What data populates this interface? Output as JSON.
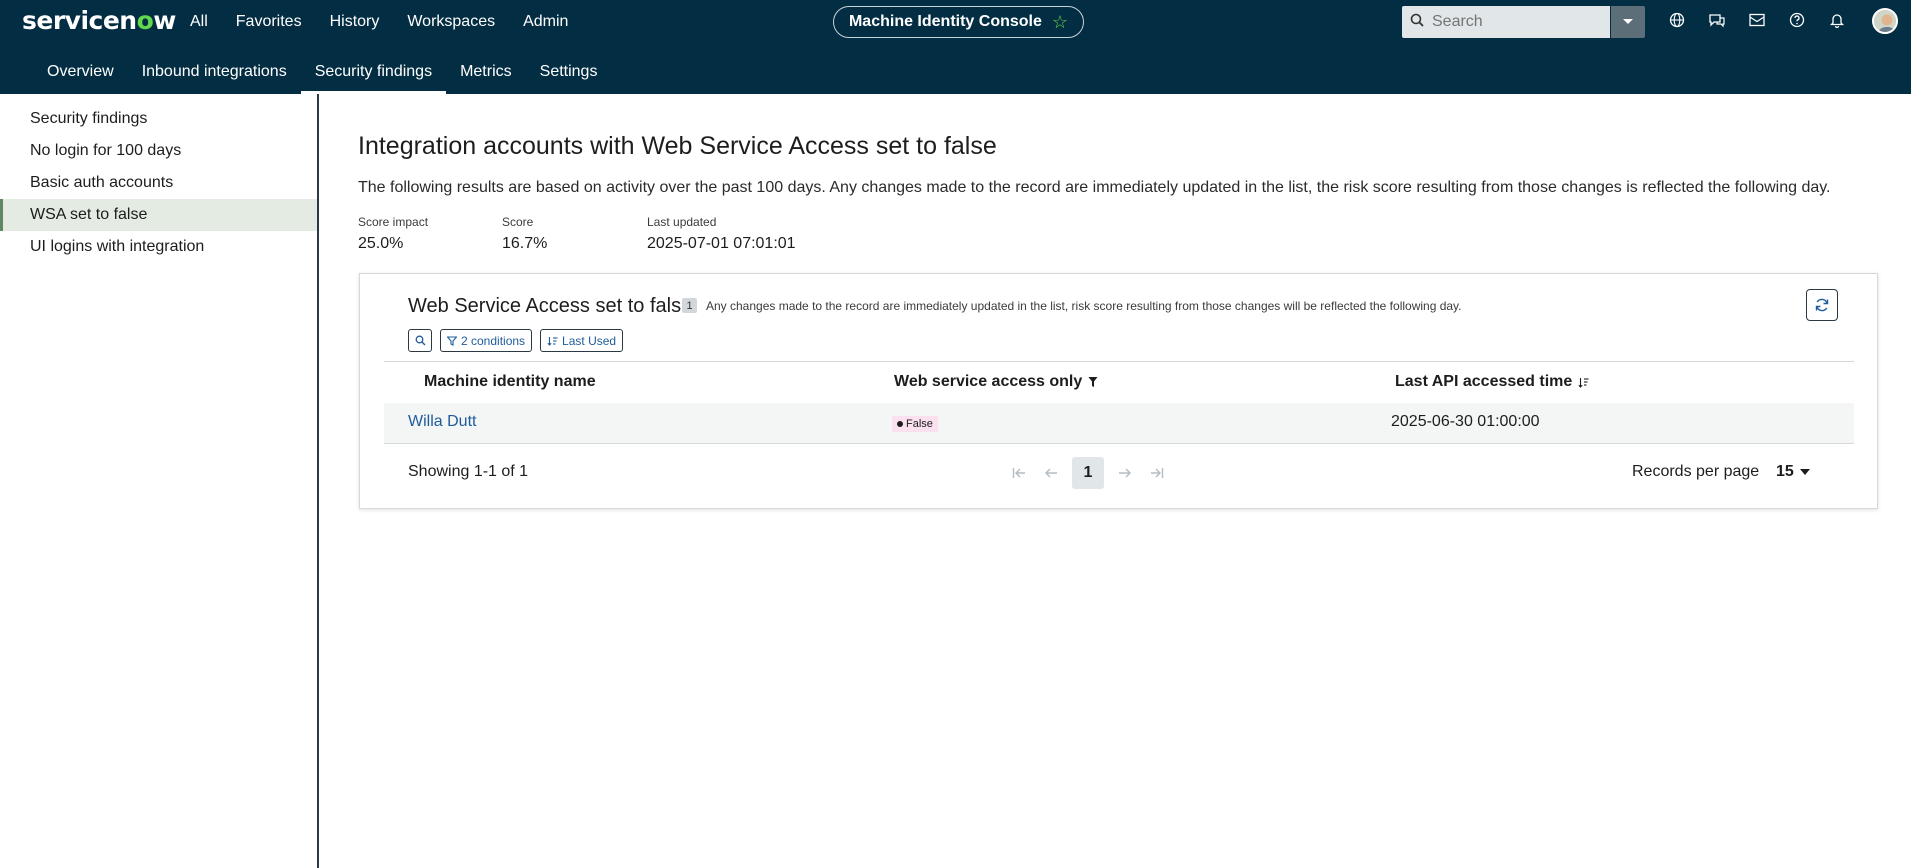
{
  "app": {
    "logo_prefix": "servicen",
    "logo_o": "o",
    "logo_suffix": "w",
    "console_name": "Machine Identity Console"
  },
  "nav": {
    "items": [
      "All",
      "Favorites",
      "History",
      "Workspaces",
      "Admin"
    ]
  },
  "search": {
    "placeholder": "Search"
  },
  "header_icons": [
    "globe-icon",
    "chat-icon",
    "inbox-icon",
    "help-icon",
    "bell-icon"
  ],
  "tabs": [
    {
      "label": "Overview",
      "active": false
    },
    {
      "label": "Inbound integrations",
      "active": false
    },
    {
      "label": "Security findings",
      "active": true
    },
    {
      "label": "Metrics",
      "active": false
    },
    {
      "label": "Settings",
      "active": false
    }
  ],
  "sidebar": {
    "items": [
      {
        "label": "Security findings",
        "active": false
      },
      {
        "label": "No login for 100 days",
        "active": false
      },
      {
        "label": "Basic auth accounts",
        "active": false
      },
      {
        "label": "WSA set to false",
        "active": true
      },
      {
        "label": "UI logins with integration",
        "active": false
      }
    ]
  },
  "page": {
    "title": "Integration accounts with Web Service Access set to false",
    "description": "The following results are based on activity over the past 100 days. Any changes made to the record are immediately updated in the list, the risk score resulting from those changes is reflected the following day.",
    "stats": [
      {
        "label": "Score impact",
        "value": "25.0%"
      },
      {
        "label": "Score",
        "value": "16.7%"
      },
      {
        "label": "Last updated",
        "value": "2025-07-01 07:01:01"
      }
    ]
  },
  "card": {
    "title": "Web Service Access set to false",
    "count": "1",
    "note": "Any changes made to the record are immediately updated in the list, risk score resulting from those changes will be reflected the following day.",
    "chips": {
      "conditions": "2 conditions",
      "sort": "Last Used"
    },
    "columns": [
      "Machine identity name",
      "Web service access only",
      "Last API accessed time"
    ],
    "rows": [
      {
        "name": "Willa Dutt",
        "wsa": "False",
        "last_access": "2025-06-30 01:00:00"
      }
    ],
    "footer": {
      "showing": "Showing 1-1 of 1",
      "current_page": "1",
      "records_per_page_label": "Records per page",
      "records_per_page": "15"
    }
  },
  "colors": {
    "header_bg": "#032d42",
    "accent_green": "#62d84e",
    "link": "#1f5c9b",
    "active_side_bg": "#e3ebe3",
    "badge_false_bg": "#fbe0ef"
  }
}
